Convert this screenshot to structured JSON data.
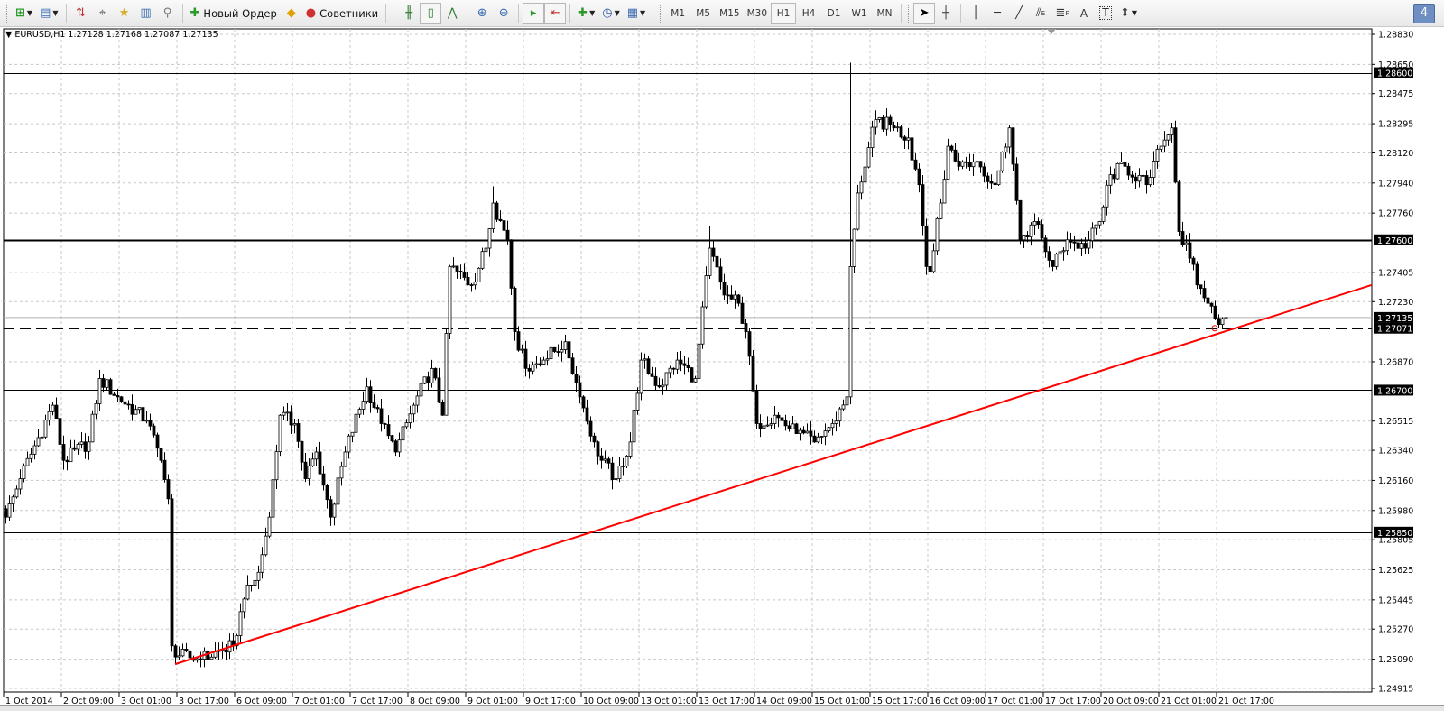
{
  "toolbar": {
    "new_order_label": "Новый Ордер",
    "experts_label": "Советники",
    "timeframes": [
      "M1",
      "M5",
      "M15",
      "M30",
      "H1",
      "H4",
      "D1",
      "W1",
      "MN"
    ],
    "active_timeframe": "H1",
    "draw_tools": {
      "text_tool": "A",
      "channel_suffix": "E",
      "fibo_suffix": "F",
      "label_tool": "T"
    },
    "notifications_count": "4"
  },
  "chart": {
    "legend": "EURUSD,H1  1.27128 1.27168 1.27087 1.27135",
    "colors": {
      "trendline": "#ff0000",
      "bull_body": "#ffffff",
      "bear_body": "#000000",
      "grid": "#c0c0c0"
    }
  },
  "chart_data": {
    "type": "candlestick",
    "symbol": "EURUSD",
    "timeframe": "H1",
    "last_ohlc": {
      "open": 1.27128,
      "high": 1.27168,
      "low": 1.27087,
      "close": 1.27135
    },
    "ylim": [
      1.24915,
      1.2883
    ],
    "price_ticks": [
      "1.28830",
      "1.28650",
      "1.28475",
      "1.28295",
      "1.28120",
      "1.27940",
      "1.27760",
      "1.27405",
      "1.27230",
      "1.26870",
      "1.26515",
      "1.26340",
      "1.26160",
      "1.25980",
      "1.25805",
      "1.25625",
      "1.25445",
      "1.25270",
      "1.25090",
      "1.24915"
    ],
    "time_ticks": [
      "1 Oct 2014",
      "2 Oct 09:00",
      "3 Oct 01:00",
      "3 Oct 17:00",
      "6 Oct 09:00",
      "7 Oct 01:00",
      "7 Oct 17:00",
      "8 Oct 09:00",
      "9 Oct 01:00",
      "9 Oct 17:00",
      "10 Oct 09:00",
      "13 Oct 01:00",
      "13 Oct 17:00",
      "14 Oct 09:00",
      "15 Oct 01:00",
      "15 Oct 17:00",
      "16 Oct 09:00",
      "17 Oct 01:00",
      "17 Oct 17:00",
      "20 Oct 09:00",
      "21 Oct 01:00",
      "21 Oct 17:00"
    ],
    "bars_per_time_tick": 16,
    "close_waypoints": [
      [
        0,
        1.2594
      ],
      [
        4,
        1.2617
      ],
      [
        13,
        1.2661
      ],
      [
        16,
        1.2628
      ],
      [
        23,
        1.2639
      ],
      [
        26,
        1.2677
      ],
      [
        31,
        1.2666
      ],
      [
        39,
        1.2652
      ],
      [
        43,
        1.2628
      ],
      [
        45,
        1.2605
      ],
      [
        46,
        1.2517
      ],
      [
        48,
        1.2511
      ],
      [
        54,
        1.2509
      ],
      [
        63,
        1.2517
      ],
      [
        66,
        1.2545
      ],
      [
        70,
        1.2561
      ],
      [
        73,
        1.2594
      ],
      [
        76,
        1.2655
      ],
      [
        80,
        1.265
      ],
      [
        83,
        1.2617
      ],
      [
        86,
        1.2633
      ],
      [
        90,
        1.2594
      ],
      [
        94,
        1.2633
      ],
      [
        100,
        1.2672
      ],
      [
        104,
        1.265
      ],
      [
        108,
        1.2633
      ],
      [
        113,
        1.2661
      ],
      [
        118,
        1.2683
      ],
      [
        121,
        1.2655
      ],
      [
        123,
        1.2744
      ],
      [
        129,
        1.2733
      ],
      [
        133,
        1.2755
      ],
      [
        135,
        1.2782
      ],
      [
        139,
        1.276
      ],
      [
        141,
        1.2705
      ],
      [
        144,
        1.2683
      ],
      [
        149,
        1.2688
      ],
      [
        155,
        1.2699
      ],
      [
        159,
        1.2666
      ],
      [
        163,
        1.2639
      ],
      [
        165,
        1.2628
      ],
      [
        169,
        1.2617
      ],
      [
        173,
        1.2639
      ],
      [
        176,
        1.2688
      ],
      [
        181,
        1.2672
      ],
      [
        186,
        1.2688
      ],
      [
        191,
        1.2677
      ],
      [
        195,
        1.2755
      ],
      [
        199,
        1.2727
      ],
      [
        203,
        1.2722
      ],
      [
        205,
        1.2705
      ],
      [
        208,
        1.265
      ],
      [
        213,
        1.2655
      ],
      [
        219,
        1.2644
      ],
      [
        224,
        1.2639
      ],
      [
        229,
        1.265
      ],
      [
        233,
        1.2666
      ],
      [
        234,
        1.2744
      ],
      [
        236,
        1.2788
      ],
      [
        241,
        1.2832
      ],
      [
        246,
        1.2827
      ],
      [
        250,
        1.2821
      ],
      [
        253,
        1.2793
      ],
      [
        255,
        1.2744
      ],
      [
        256,
        1.2741
      ],
      [
        259,
        1.2782
      ],
      [
        261,
        1.2816
      ],
      [
        264,
        1.2804
      ],
      [
        269,
        1.2807
      ],
      [
        274,
        1.2793
      ],
      [
        278,
        1.2827
      ],
      [
        281,
        1.276
      ],
      [
        285,
        1.2771
      ],
      [
        290,
        1.2744
      ],
      [
        294,
        1.276
      ],
      [
        299,
        1.2755
      ],
      [
        303,
        1.2771
      ],
      [
        306,
        1.2799
      ],
      [
        310,
        1.2804
      ],
      [
        316,
        1.2793
      ],
      [
        320,
        1.2816
      ],
      [
        323,
        1.2827
      ],
      [
        325,
        1.2765
      ],
      [
        328,
        1.2749
      ],
      [
        330,
        1.2733
      ],
      [
        333,
        1.2722
      ],
      [
        335,
        1.2713
      ],
      [
        337,
        1.27128
      ],
      [
        338,
        1.27135
      ]
    ],
    "spikes": [
      {
        "bar": 234,
        "high": 1.2866
      },
      {
        "bar": 256,
        "low": 1.2708
      },
      {
        "bar": 47,
        "low": 1.2506
      },
      {
        "bar": 135,
        "high": 1.2792
      },
      {
        "bar": 195,
        "high": 1.2768
      },
      {
        "bar": 338,
        "high": 1.27168,
        "low": 1.27087
      }
    ],
    "horizontal_levels": [
      {
        "price": "1.28600",
        "style": "solid"
      },
      {
        "price": "1.27600",
        "style": "solid-bold"
      },
      {
        "price": "1.26700",
        "style": "solid"
      },
      {
        "price": "1.25850",
        "style": "solid"
      },
      {
        "price": "1.27071",
        "style": "dashed"
      }
    ],
    "bid_line": "1.27135",
    "trendline": {
      "from": {
        "bar": 47,
        "price": 1.2506
      },
      "to": {
        "bar": 379,
        "price": 1.2733
      },
      "color": "#ff0000"
    }
  }
}
